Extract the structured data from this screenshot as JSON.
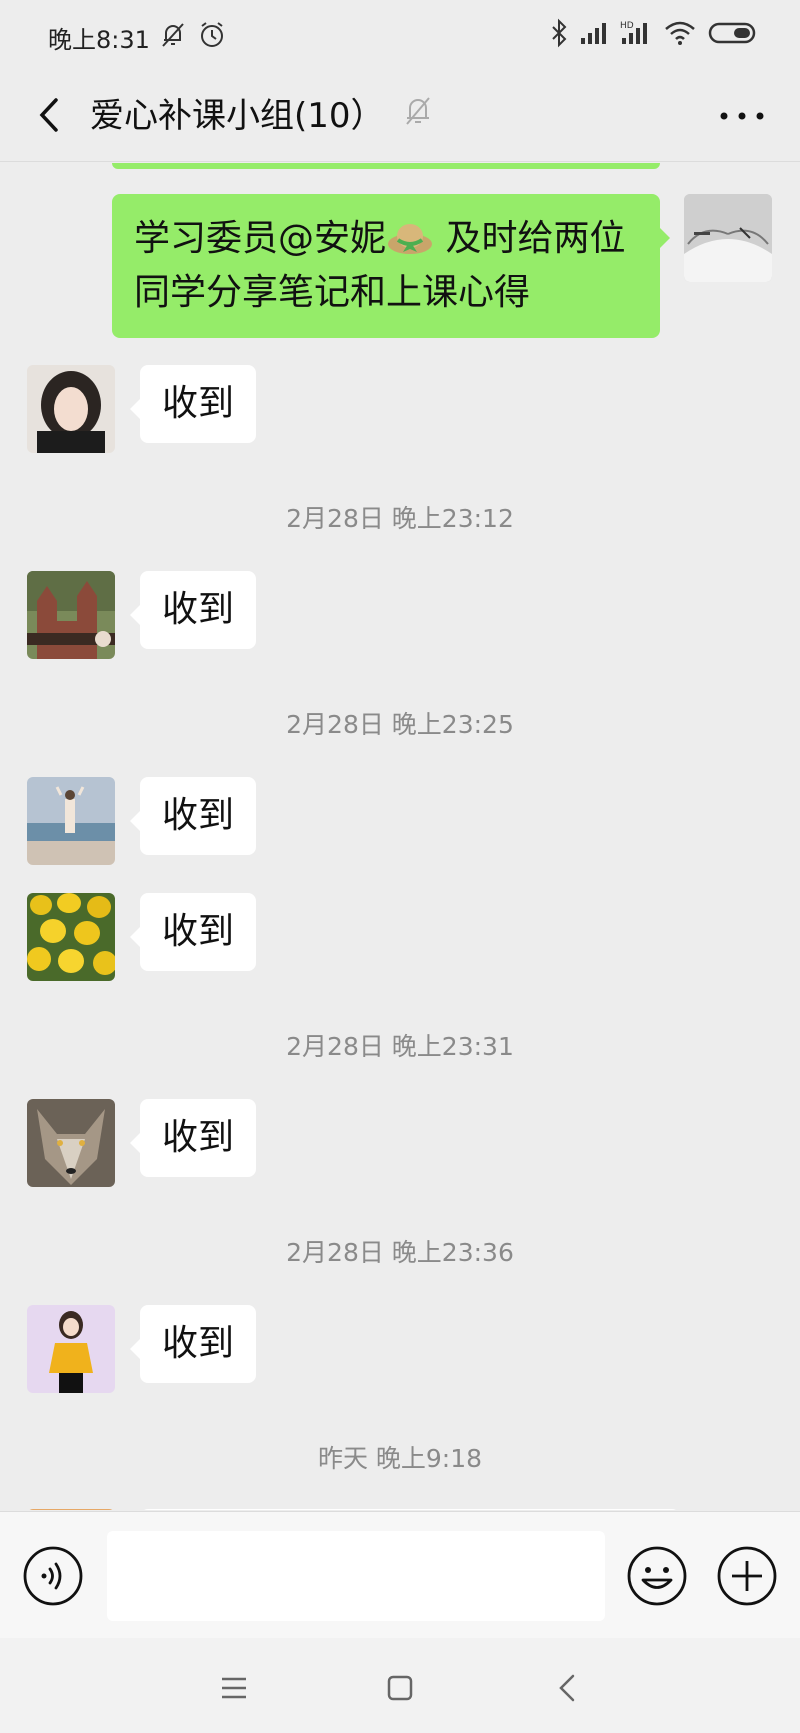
{
  "status_bar": {
    "time": "晚上8:31",
    "icons_left": [
      "bell-off-icon",
      "alarm-icon"
    ],
    "icons_right": [
      "bluetooth-icon",
      "signal-icon",
      "hd-signal-icon",
      "wifi-icon",
      "battery-icon"
    ]
  },
  "header": {
    "title": "爱心补课小组(10）",
    "mute_icon": "bell-off-icon",
    "more_icon": "more-dots-icon",
    "back_icon": "chevron-left-icon"
  },
  "messages": [
    {
      "side": "right",
      "avatar": "open-book-avatar",
      "text_before": "学习委员@安妮",
      "emoji": "straw-hat-emoji",
      "text_after": " 及时给两位同学分享笔记和上课心得"
    },
    {
      "side": "left",
      "avatar": "girl-portrait-avatar",
      "text": "收到"
    },
    {
      "type": "time",
      "text": "2月28日 晚上23:12"
    },
    {
      "side": "left",
      "avatar": "temple-ruins-avatar",
      "text": "收到"
    },
    {
      "type": "time",
      "text": "2月28日 晚上23:25"
    },
    {
      "side": "left",
      "avatar": "beach-person-avatar",
      "text": "收到"
    },
    {
      "side": "left",
      "avatar": "yellow-tulips-avatar",
      "text": "收到"
    },
    {
      "type": "time",
      "text": "2月28日 晚上23:31"
    },
    {
      "side": "left",
      "avatar": "wolf-avatar",
      "text": "收到"
    },
    {
      "type": "time",
      "text": "2月28日 晚上23:36"
    },
    {
      "side": "left",
      "avatar": "illustrated-girl-avatar",
      "text": "收到"
    },
    {
      "type": "time",
      "text": "昨天 晚上9:18"
    }
  ],
  "input_bar": {
    "voice_icon": "voice-input-icon",
    "input_value": "",
    "emoji_icon": "emoji-icon",
    "plus_icon": "plus-icon"
  },
  "nav_bar": {
    "icons": [
      "menu-icon",
      "home-square-icon",
      "back-triangle-icon"
    ]
  },
  "colors": {
    "background": "#ededed",
    "green_bubble": "#95ec69",
    "white_bubble": "#ffffff",
    "timestamp_text": "#8a8a8a"
  }
}
